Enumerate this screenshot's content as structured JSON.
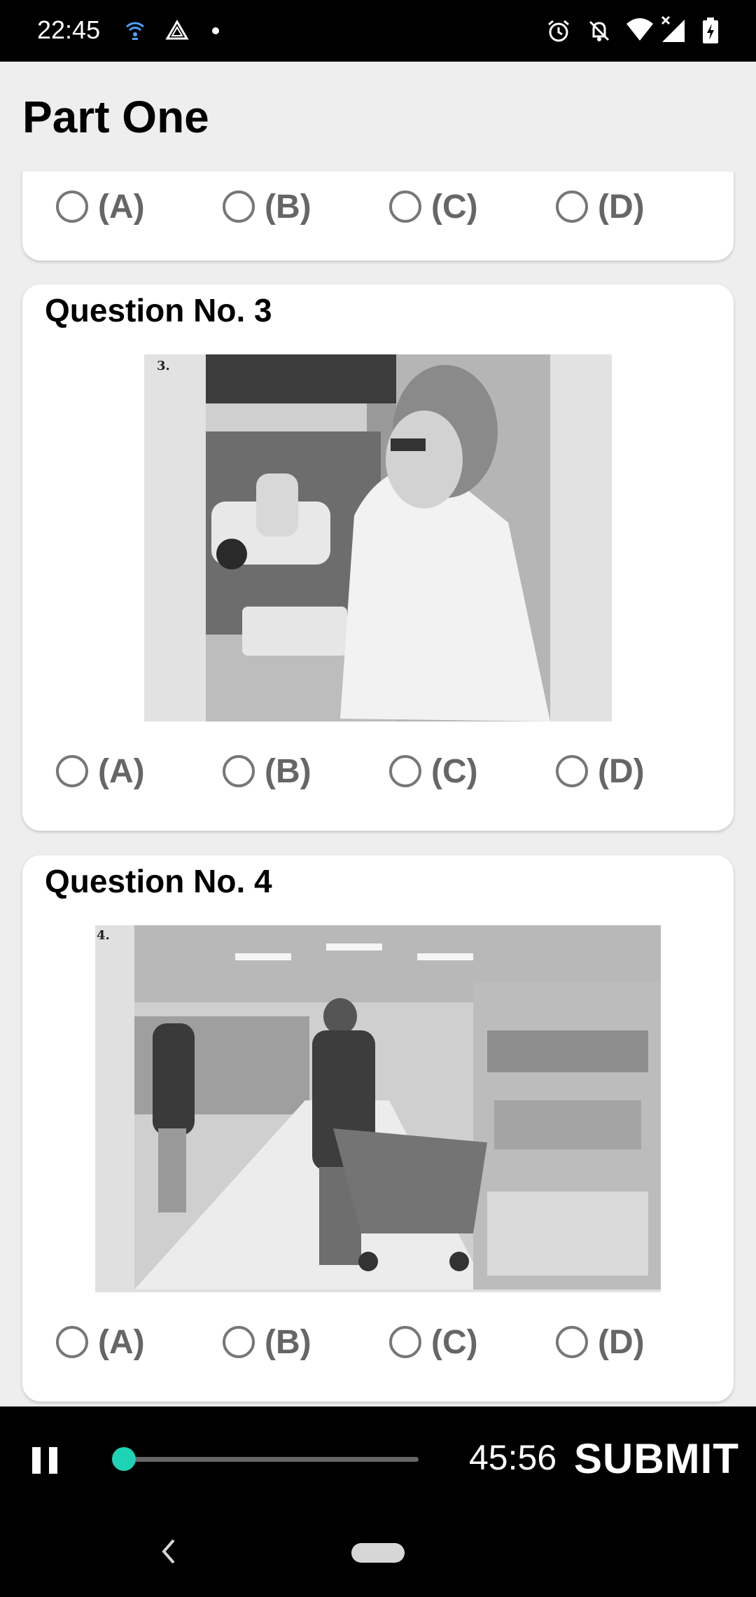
{
  "status_bar": {
    "time": "22:45",
    "left_icons": [
      "wifi-calling-icon",
      "drive-icon",
      "dot-icon"
    ],
    "right_icons": [
      "alarm-icon",
      "notifications-off-icon",
      "wifi-icon",
      "cellular-no-signal-icon",
      "battery-charging-icon"
    ]
  },
  "header": {
    "title": "Part One"
  },
  "options": [
    "(A)",
    "(B)",
    "(C)",
    "(D)"
  ],
  "questions": [
    {
      "title": ""
    },
    {
      "title": "Question No. 3",
      "photo_label": "3."
    },
    {
      "title": "Question No. 4",
      "photo_label": "4."
    }
  ],
  "player": {
    "time_remaining": "45:56",
    "progress": 0.02,
    "submit_label": "SUBMIT"
  },
  "colors": {
    "accent": "#1ed2b6",
    "page_background": "#eeeeee",
    "card_background": "#ffffff"
  }
}
